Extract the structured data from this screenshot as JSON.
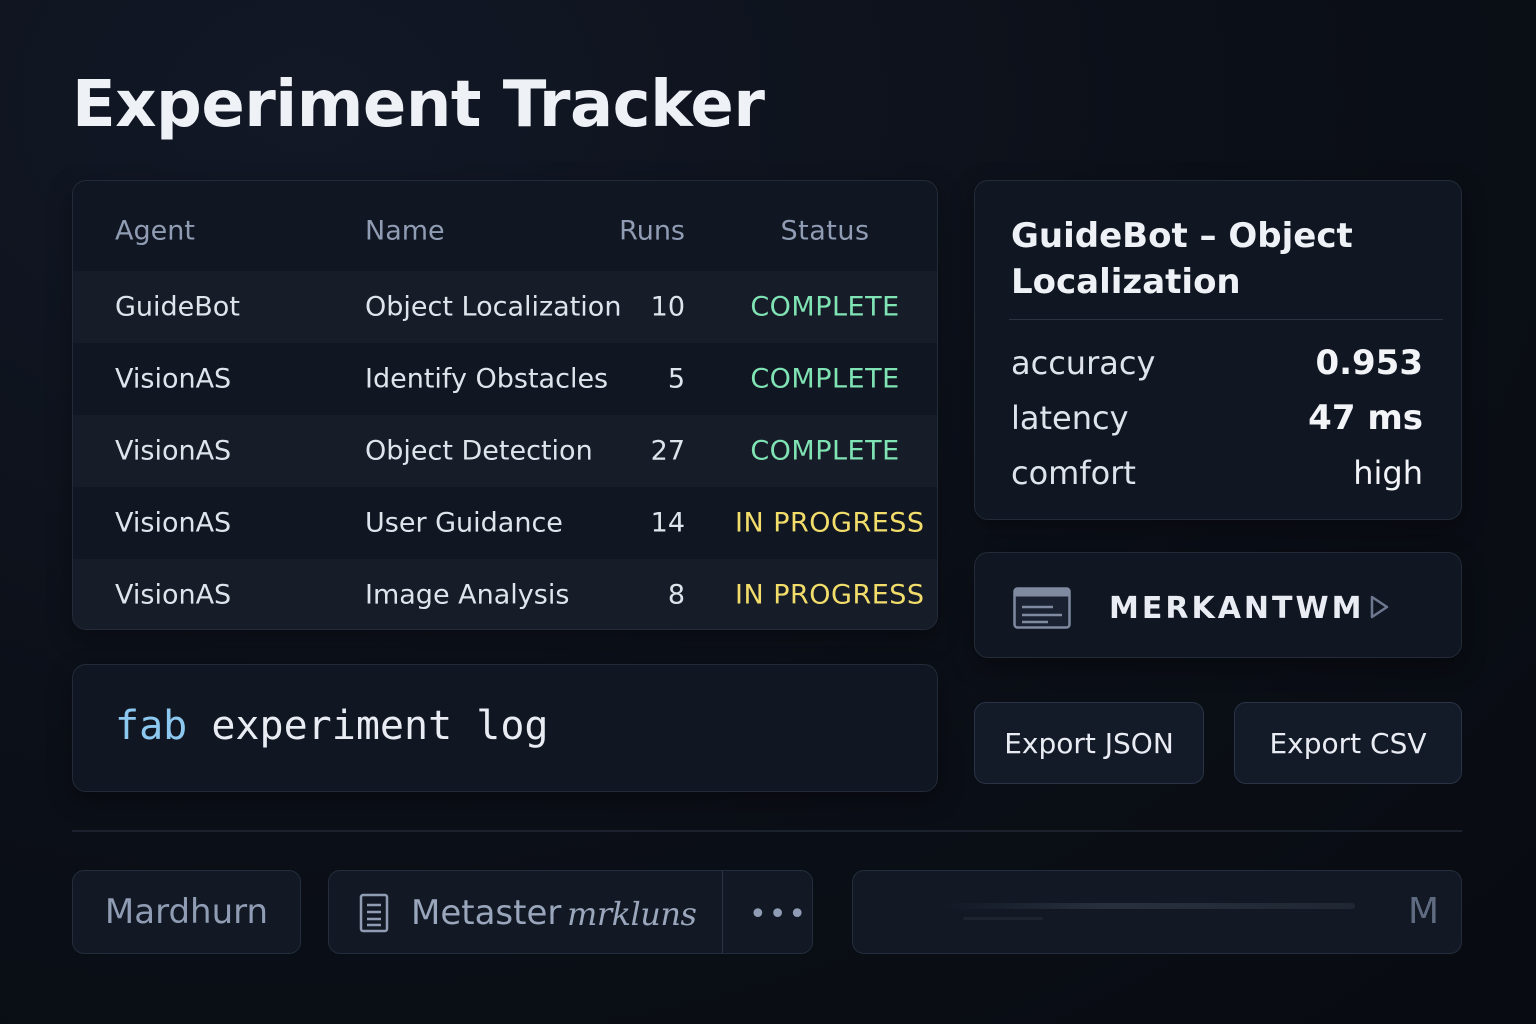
{
  "page": {
    "title": "Experiment Tracker"
  },
  "table": {
    "columns": [
      "Agent",
      "Name",
      "Runs",
      "Status"
    ],
    "rows": [
      {
        "agent": "GuideBot",
        "name": "Object Localization",
        "runs": "10",
        "status": "COMPLETE"
      },
      {
        "agent": "VisionAS",
        "name": "Identify Obstacles",
        "runs": "5",
        "status": "COMPLETE"
      },
      {
        "agent": "VisionAS",
        "name": "Object Detection",
        "runs": "27",
        "status": "COMPLETE"
      },
      {
        "agent": "VisionAS",
        "name": "User Guidance",
        "runs": "14",
        "status": "IN PROGRESS"
      },
      {
        "agent": "VisionAS",
        "name": "Image Analysis",
        "runs": "8",
        "status": "IN PROGRESS"
      }
    ],
    "status_colors": {
      "COMPLETE": "#7fe3b4",
      "IN PROGRESS": "#f2dd6b"
    }
  },
  "command": {
    "keyword": "fab",
    "rest": "experiment log"
  },
  "detail": {
    "title": "GuideBot – Object Localization",
    "metrics": [
      {
        "label": "accuracy",
        "value": "0.953"
      },
      {
        "label": "latency",
        "value": "47 ms"
      },
      {
        "label": "comfort",
        "value": "high"
      }
    ]
  },
  "brand": {
    "name": "MERKANTWM",
    "icon": "document-card-icon",
    "action_icon": "play-icon"
  },
  "export": {
    "json_label": "Export JSON",
    "csv_label": "Export CSV"
  },
  "bottom": {
    "pill_a_label": "Mardhurn",
    "pill_b_label": "Metaster",
    "pill_b_script": "mrkluns",
    "pill_b_icon": "document-icon",
    "more_icon": "•••",
    "pill_c_letter": "M"
  },
  "colors": {
    "background": "#0b0f17",
    "panel": "#111722",
    "accent_complete": "#7fe3b4",
    "accent_progress": "#f2dd6b"
  }
}
